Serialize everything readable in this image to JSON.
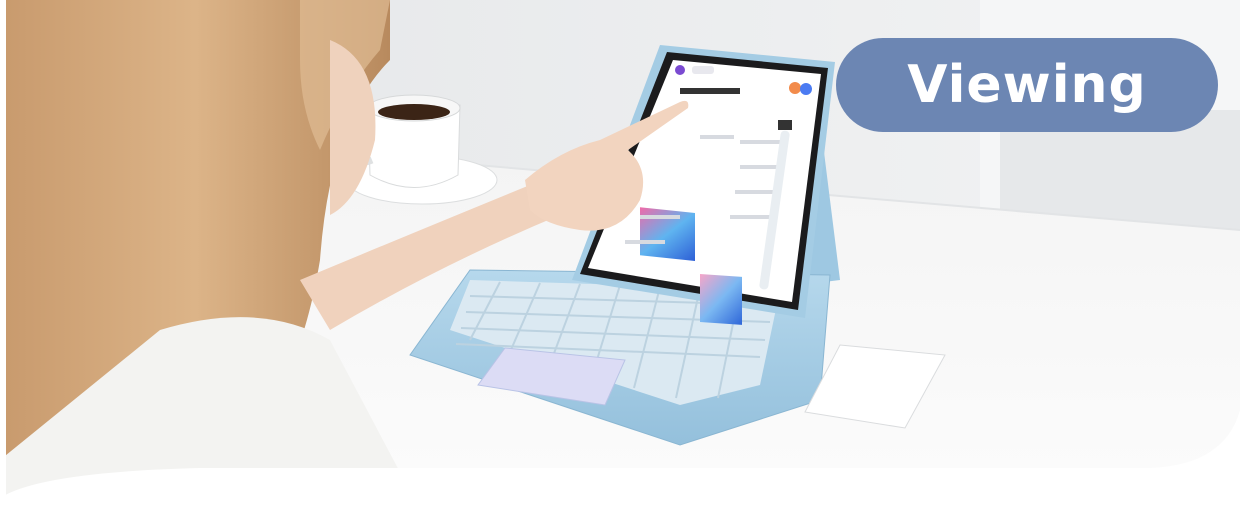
{
  "badge": {
    "label": "Viewing"
  },
  "colors": {
    "badge": "#6c86b3",
    "keyboard_case": "#a9cfe6",
    "table": "#f7f7f7",
    "background": "#e9ebee"
  }
}
